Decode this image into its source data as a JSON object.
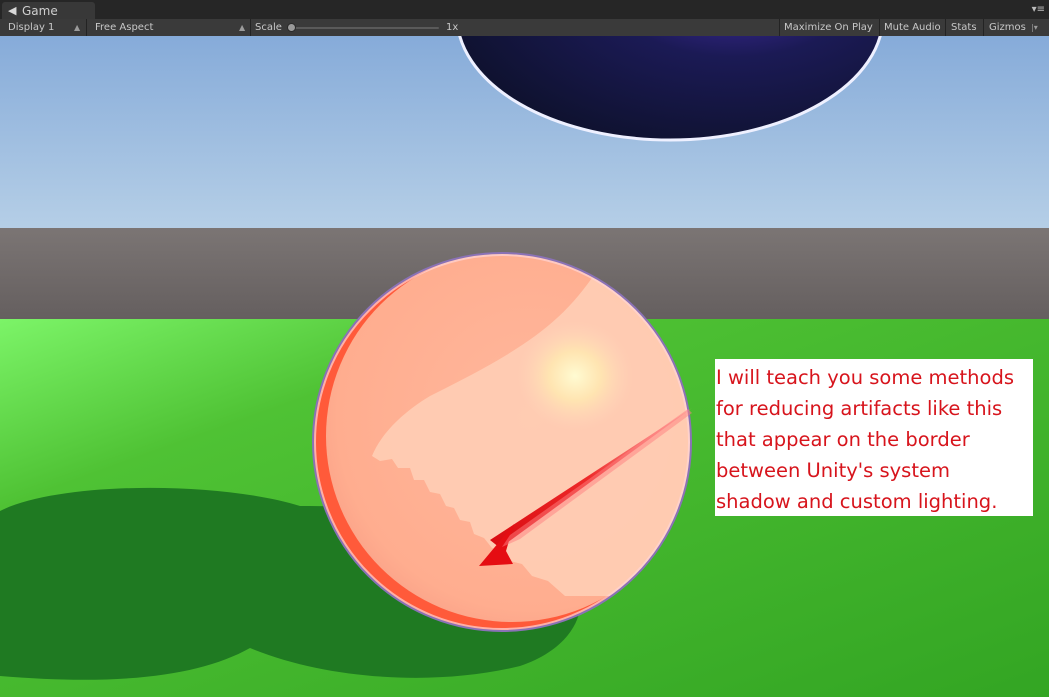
{
  "window": {
    "tab_title": "Game",
    "tab_icon": "game-icon",
    "tab_menu_icon": "panel-menu-icon"
  },
  "toolbar": {
    "display_label": "Display 1",
    "aspect_label": "Free Aspect",
    "scale_label": "Scale",
    "scale_value": "1x",
    "scale_fraction": 0.0,
    "maximize_label": "Maximize On Play",
    "mute_label": "Mute Audio",
    "stats_label": "Stats",
    "gizmos_label": "Gizmos"
  },
  "callout": {
    "lines": [
      "I will teach you some methods",
      "for reducing artifacts like this",
      "that appear on the border",
      "between Unity's system",
      "shadow and custom lighting."
    ],
    "text_color": "#d7141c"
  },
  "colors": {
    "editor_bg": "#3a3a3a",
    "sky_top": "#8db1dc",
    "ground_green": "#45b52b",
    "sphere_peach": "#ffb597",
    "dark_sphere": "#15163a",
    "arrow_red": "#e50d12"
  }
}
